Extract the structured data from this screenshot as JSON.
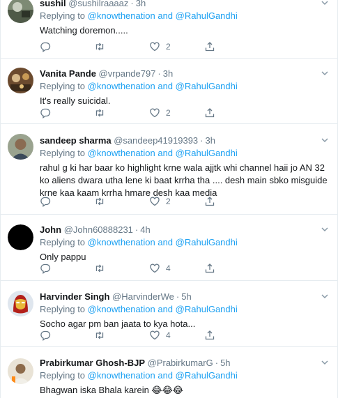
{
  "tweets": [
    {
      "name": "sushil",
      "handle": "@sushilraaaaz",
      "time": "3h",
      "replying_prefix": "Replying to",
      "mention1": "@knowthenation",
      "and": "and",
      "mention2": "@RahulGandhi",
      "text": "Watching doremon.....",
      "likes": "2"
    },
    {
      "name": "Vanita Pande",
      "handle": "@vrpande797",
      "time": "3h",
      "replying_prefix": "Replying to",
      "mention1": "@knowthenation",
      "and": "and",
      "mention2": "@RahulGandhi",
      "text": "It's really suicidal.",
      "likes": "2"
    },
    {
      "name": "sandeep sharma",
      "handle": "@sandeep41919393",
      "time": "3h",
      "replying_prefix": "Replying to",
      "mention1": "@knowthenation",
      "and": "and",
      "mention2": "@RahulGandhi",
      "text": "rahul g ki har baar ko highlight krne wala ajjtk whi channel haii jo AN 32 ko aliens dwara utha lene ki baat krrha tha .... desh main sbko misguide krne kaa kaam krrha hmare desh kaa media",
      "likes": "2"
    },
    {
      "name": "John",
      "handle": "@John60888231",
      "time": "4h",
      "replying_prefix": "Replying to",
      "mention1": "@knowthenation",
      "and": "and",
      "mention2": "@RahulGandhi",
      "text": "Only pappu",
      "likes": "4"
    },
    {
      "name": "Harvinder Singh",
      "handle": "@HarvinderWe",
      "time": "5h",
      "replying_prefix": "Replying to",
      "mention1": "@knowthenation",
      "and": "and",
      "mention2": "@RahulGandhi",
      "text": "Socho agar pm ban jaata to kya hota...",
      "likes": "4"
    },
    {
      "name": "Prabirkumar Ghosh-BJP",
      "handle": "@PrabirkumarG",
      "time": "5h",
      "replying_prefix": "Replying to",
      "mention1": "@knowthenation",
      "and": "and",
      "mention2": "@RahulGandhi",
      "text": "Bhagwan iska Bhala karein 😂😂😂",
      "likes": ""
    }
  ],
  "icons": {
    "reply": "reply-icon",
    "retweet": "retweet-icon",
    "like": "heart-icon",
    "share": "share-icon",
    "caret": "chevron-down-icon"
  },
  "colors": {
    "link": "#1da1f2",
    "muted": "#657786",
    "text": "#14171a",
    "border": "#e6ecf0"
  }
}
